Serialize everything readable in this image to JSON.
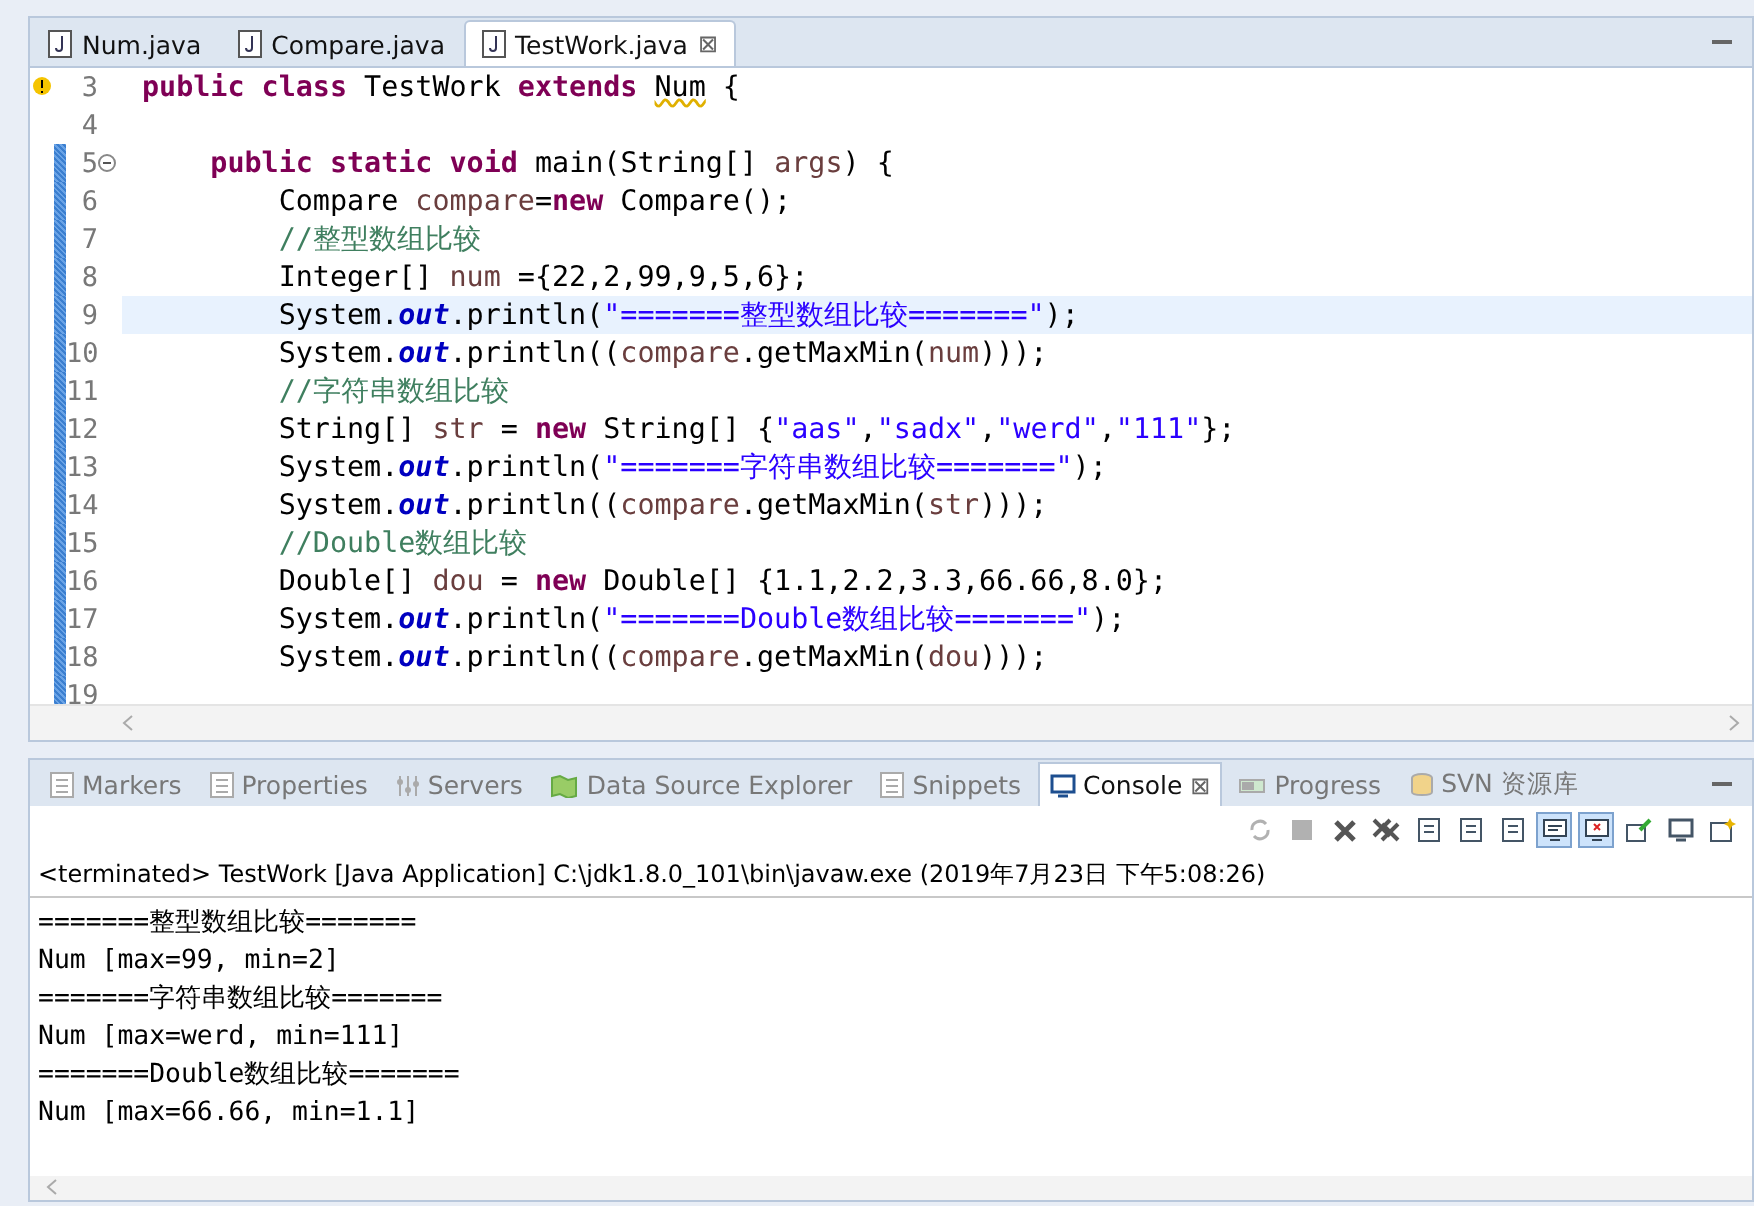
{
  "editor_tabs": [
    {
      "label": "Num.java",
      "selected": false
    },
    {
      "label": "Compare.java",
      "selected": false
    },
    {
      "label": "TestWork.java",
      "selected": true,
      "close": "⊠"
    }
  ],
  "code_lines": [
    {
      "number": "3",
      "warning": true,
      "fold": false,
      "changed": false,
      "current": false,
      "tokens": [
        {
          "kind": "kw",
          "text": "public "
        },
        {
          "kind": "kw",
          "text": "class "
        },
        {
          "kind": "text",
          "text": "TestWork "
        },
        {
          "kind": "kw",
          "text": "extends "
        },
        {
          "kind": "warn",
          "text": "Num"
        },
        {
          "kind": "text",
          "text": " {"
        }
      ]
    },
    {
      "number": "4",
      "warning": false,
      "fold": false,
      "changed": false,
      "current": false
    },
    {
      "number": "5",
      "warning": false,
      "fold": true,
      "changed": true,
      "current": false,
      "tokens": [
        {
          "kind": "kw",
          "text": "    public "
        },
        {
          "kind": "kw",
          "text": "static "
        },
        {
          "kind": "kw",
          "text": "void "
        },
        {
          "kind": "text",
          "text": "main(String[] "
        },
        {
          "kind": "var",
          "text": "args"
        },
        {
          "kind": "text",
          "text": ") {"
        }
      ]
    },
    {
      "number": "6",
      "warning": false,
      "fold": false,
      "changed": true,
      "current": false,
      "tokens": [
        {
          "kind": "text",
          "text": "        Compare "
        },
        {
          "kind": "var",
          "text": "compare"
        },
        {
          "kind": "text",
          "text": "="
        },
        {
          "kind": "kw",
          "text": "new"
        },
        {
          "kind": "text",
          "text": " Compare();"
        }
      ]
    },
    {
      "number": "7",
      "warning": false,
      "fold": false,
      "changed": true,
      "current": false,
      "tokens": [
        {
          "kind": "comment",
          "text": "        //整型数组比较"
        }
      ]
    },
    {
      "number": "8",
      "warning": false,
      "fold": false,
      "changed": true,
      "current": false,
      "tokens": [
        {
          "kind": "text",
          "text": "        Integer[] "
        },
        {
          "kind": "var",
          "text": "num"
        },
        {
          "kind": "text",
          "text": " ={22,2,99,9,5,6};"
        }
      ]
    },
    {
      "number": "9",
      "warning": false,
      "fold": false,
      "changed": true,
      "current": true,
      "tokens": [
        {
          "kind": "text",
          "text": "        System."
        },
        {
          "kind": "static",
          "text": "out"
        },
        {
          "kind": "text",
          "text": ".println("
        },
        {
          "kind": "str",
          "text": "\"=======整型数组比较=======\""
        },
        {
          "kind": "text",
          "text": ");"
        }
      ]
    },
    {
      "number": "10",
      "warning": false,
      "fold": false,
      "changed": true,
      "current": false,
      "tokens": [
        {
          "kind": "text",
          "text": "        System."
        },
        {
          "kind": "static",
          "text": "out"
        },
        {
          "kind": "text",
          "text": ".println(("
        },
        {
          "kind": "var",
          "text": "compare"
        },
        {
          "kind": "text",
          "text": ".getMaxMin("
        },
        {
          "kind": "var",
          "text": "num"
        },
        {
          "kind": "text",
          "text": ")));"
        }
      ]
    },
    {
      "number": "11",
      "warning": false,
      "fold": false,
      "changed": true,
      "current": false,
      "tokens": [
        {
          "kind": "comment",
          "text": "        //字符串数组比较"
        }
      ]
    },
    {
      "number": "12",
      "warning": false,
      "fold": false,
      "changed": true,
      "current": false,
      "tokens": [
        {
          "kind": "text",
          "text": "        String[] "
        },
        {
          "kind": "var",
          "text": "str"
        },
        {
          "kind": "text",
          "text": " = "
        },
        {
          "kind": "kw",
          "text": "new"
        },
        {
          "kind": "text",
          "text": " String[] {"
        },
        {
          "kind": "str",
          "text": "\"aas\""
        },
        {
          "kind": "text",
          "text": ","
        },
        {
          "kind": "str",
          "text": "\"sadx\""
        },
        {
          "kind": "text",
          "text": ","
        },
        {
          "kind": "str",
          "text": "\"werd\""
        },
        {
          "kind": "text",
          "text": ","
        },
        {
          "kind": "str",
          "text": "\"111\""
        },
        {
          "kind": "text",
          "text": "};"
        }
      ]
    },
    {
      "number": "13",
      "warning": false,
      "fold": false,
      "changed": true,
      "current": false,
      "tokens": [
        {
          "kind": "text",
          "text": "        System."
        },
        {
          "kind": "static",
          "text": "out"
        },
        {
          "kind": "text",
          "text": ".println("
        },
        {
          "kind": "str",
          "text": "\"=======字符串数组比较=======\""
        },
        {
          "kind": "text",
          "text": ");"
        }
      ]
    },
    {
      "number": "14",
      "warning": false,
      "fold": false,
      "changed": true,
      "current": false,
      "tokens": [
        {
          "kind": "text",
          "text": "        System."
        },
        {
          "kind": "static",
          "text": "out"
        },
        {
          "kind": "text",
          "text": ".println(("
        },
        {
          "kind": "var",
          "text": "compare"
        },
        {
          "kind": "text",
          "text": ".getMaxMin("
        },
        {
          "kind": "var",
          "text": "str"
        },
        {
          "kind": "text",
          "text": ")));"
        }
      ]
    },
    {
      "number": "15",
      "warning": false,
      "fold": false,
      "changed": true,
      "current": false,
      "tokens": [
        {
          "kind": "comment",
          "text": "        //Double数组比较"
        }
      ]
    },
    {
      "number": "16",
      "warning": false,
      "fold": false,
      "changed": true,
      "current": false,
      "tokens": [
        {
          "kind": "text",
          "text": "        Double[] "
        },
        {
          "kind": "var",
          "text": "dou"
        },
        {
          "kind": "text",
          "text": " = "
        },
        {
          "kind": "kw",
          "text": "new"
        },
        {
          "kind": "text",
          "text": " Double[] {1.1,2.2,3.3,66.66,8.0};"
        }
      ]
    },
    {
      "number": "17",
      "warning": false,
      "fold": false,
      "changed": true,
      "current": false,
      "tokens": [
        {
          "kind": "text",
          "text": "        System."
        },
        {
          "kind": "static",
          "text": "out"
        },
        {
          "kind": "text",
          "text": ".println("
        },
        {
          "kind": "str",
          "text": "\"=======Double数组比较=======\""
        },
        {
          "kind": "text",
          "text": ");"
        }
      ]
    },
    {
      "number": "18",
      "warning": false,
      "fold": false,
      "changed": true,
      "current": false,
      "tokens": [
        {
          "kind": "text",
          "text": "        System."
        },
        {
          "kind": "static",
          "text": "out"
        },
        {
          "kind": "text",
          "text": ".println(("
        },
        {
          "kind": "var",
          "text": "compare"
        },
        {
          "kind": "text",
          "text": ".getMaxMin("
        },
        {
          "kind": "var",
          "text": "dou"
        },
        {
          "kind": "text",
          "text": ")));"
        }
      ]
    },
    {
      "number": "19",
      "warning": false,
      "fold": false,
      "changed": true,
      "current": false
    }
  ],
  "view_tabs": [
    {
      "label": "Markers",
      "kind": "markers",
      "selected": false
    },
    {
      "label": "Properties",
      "kind": "properties",
      "selected": false
    },
    {
      "label": "Servers",
      "kind": "servers",
      "selected": false
    },
    {
      "label": "Data Source Explorer",
      "kind": "datasource",
      "selected": false
    },
    {
      "label": "Snippets",
      "kind": "snippets",
      "selected": false
    },
    {
      "label": "Console",
      "kind": "console",
      "selected": true,
      "close": "⊠"
    },
    {
      "label": "Progress",
      "kind": "progress",
      "selected": false
    },
    {
      "label": "SVN 资源库",
      "kind": "svn",
      "selected": false
    }
  ],
  "console_toolbar": [
    {
      "kind": "sync",
      "pressed": false,
      "disabled": true
    },
    {
      "kind": "stop",
      "pressed": false,
      "disabled": true
    },
    {
      "kind": "remove",
      "pressed": false,
      "disabled": false
    },
    {
      "kind": "remove-all",
      "pressed": false,
      "disabled": false
    },
    {
      "kind": "clear",
      "pressed": false,
      "disabled": false
    },
    {
      "kind": "scroll-lock",
      "pressed": false,
      "disabled": false
    },
    {
      "kind": "word-wrap",
      "pressed": false,
      "disabled": false
    },
    {
      "kind": "show-out",
      "pressed": true,
      "disabled": false
    },
    {
      "kind": "show-err",
      "pressed": true,
      "disabled": false
    },
    {
      "kind": "pin",
      "pressed": false,
      "disabled": false
    },
    {
      "kind": "display",
      "pressed": false,
      "disabled": false
    },
    {
      "kind": "new",
      "pressed": false,
      "disabled": false
    }
  ],
  "console_header": "<terminated> TestWork [Java Application] C:\\jdk1.8.0_101\\bin\\javaw.exe (2019年7月23日 下午5:08:26)",
  "console_output": [
    "=======整型数组比较=======",
    "Num [max=99, min=2]",
    "=======字符串数组比较=======",
    "Num [max=werd, min=111]",
    "=======Double数组比较=======",
    "Num [max=66.66, min=1.1]"
  ]
}
